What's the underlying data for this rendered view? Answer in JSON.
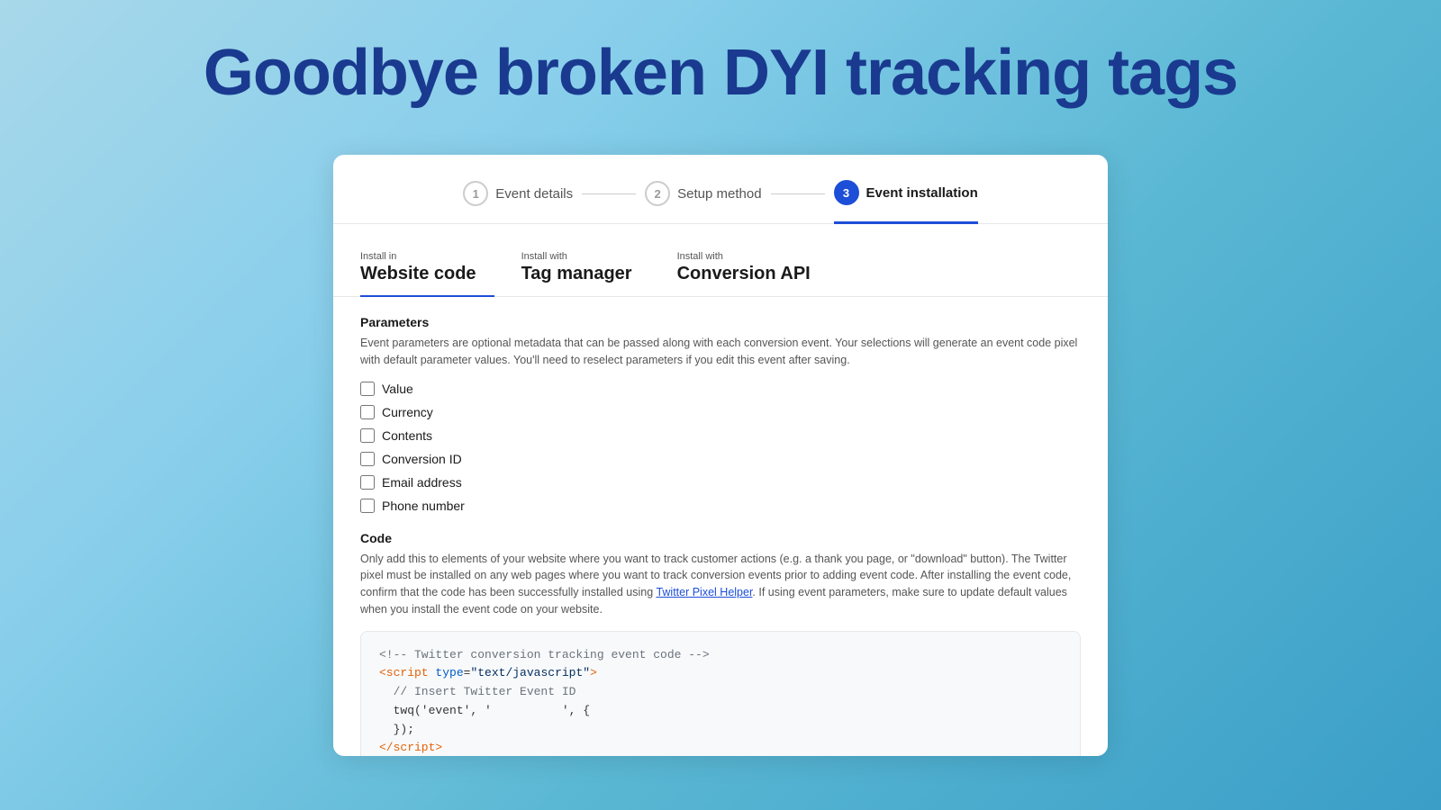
{
  "headline": "Goodbye broken DYI tracking tags",
  "stepper": {
    "steps": [
      {
        "number": "1",
        "label": "Event details",
        "active": false
      },
      {
        "number": "2",
        "label": "Setup method",
        "active": false
      },
      {
        "number": "3",
        "label": "Event installation",
        "active": true
      }
    ]
  },
  "tabs": [
    {
      "sublabel": "Install in",
      "mainlabel": "Website code",
      "active": true
    },
    {
      "sublabel": "Install with",
      "mainlabel": "Tag manager",
      "active": false
    },
    {
      "sublabel": "Install with",
      "mainlabel": "Conversion API",
      "active": false
    }
  ],
  "parameters": {
    "title": "Parameters",
    "description": "Event parameters are optional metadata that can be passed along with each conversion event. Your selections will generate an event code pixel with default parameter values. You'll need to reselect parameters if you edit this event after saving.",
    "checkboxes": [
      {
        "label": "Value"
      },
      {
        "label": "Currency"
      },
      {
        "label": "Contents"
      },
      {
        "label": "Conversion ID"
      },
      {
        "label": "Email address"
      },
      {
        "label": "Phone number"
      }
    ]
  },
  "code": {
    "title": "Code",
    "description1": "Only add this to elements of your website where you want to track customer actions (e.g. a thank you page, or \"download\" button). The Twitter pixel must be installed on any web pages where you want to track conversion events prior to adding event code. After installing the event code, confirm that the code has been successfully installed using ",
    "link_text": "Twitter Pixel Helper",
    "description2": ". If using event parameters, make sure to update default values when you install the event code on your website.",
    "code_lines": [
      "<!-- Twitter conversion tracking event code -->",
      "<script type=\"text/javascript\">",
      "  // Insert Twitter Event ID",
      "  twq('event', '          ', {",
      "  });",
      "<\\/script>"
    ]
  }
}
